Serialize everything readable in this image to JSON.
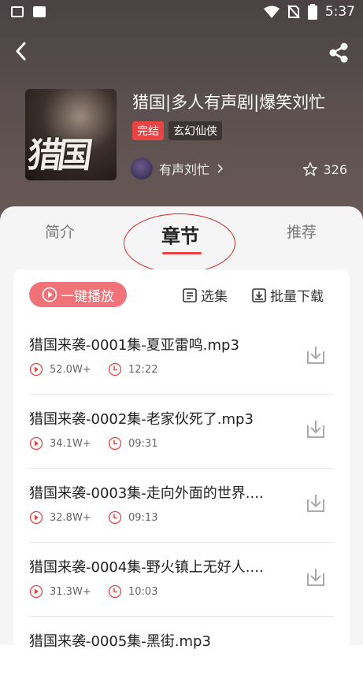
{
  "status_bar": {
    "time": "5:37"
  },
  "book": {
    "title": "猎国|多人有声剧|爆笑刘忙",
    "tag_status": "完结",
    "tag_genre": "玄幻仙侠",
    "author": "有声刘忙",
    "favorites": "326",
    "cover_text": "猎国"
  },
  "tabs": [
    "简介",
    "章节",
    "推荐"
  ],
  "actions": {
    "play_all": "一键播放",
    "select": "选集",
    "batch_download": "批量下载"
  },
  "episodes": [
    {
      "title": "猎国来袭-0001集-夏亚雷鸣.mp3",
      "plays": "52.0W+",
      "duration": "12:22"
    },
    {
      "title": "猎国来袭-0002集-老家伙死了.mp3",
      "plays": "34.1W+",
      "duration": "09:31"
    },
    {
      "title": "猎国来袭-0003集-走向外面的世界....",
      "plays": "32.8W+",
      "duration": "09:13"
    },
    {
      "title": "猎国来袭-0004集-野火镇上无好人....",
      "plays": "31.3W+",
      "duration": "10:03"
    },
    {
      "title": "猎国来袭-0005集-黑街.mp3",
      "plays": "",
      "duration": ""
    }
  ],
  "colors": {
    "accent": "#e94343"
  }
}
